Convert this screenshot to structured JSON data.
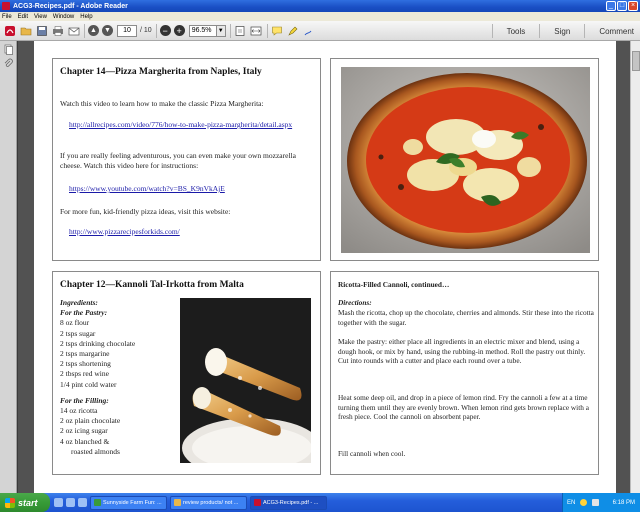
{
  "window": {
    "title": "ACG3-Recipes.pdf - Adobe Reader",
    "min": "_",
    "max": "□",
    "close": "×"
  },
  "menu": [
    "File",
    "Edit",
    "View",
    "Window",
    "Help"
  ],
  "toolbar": {
    "page_current": "10",
    "page_total": "/ 10",
    "zoom": "96.5%",
    "tools": "Tools",
    "sign": "Sign",
    "comment": "Comment"
  },
  "cards": {
    "pizza": {
      "title": "Chapter 14—Pizza Margherita from Naples, Italy",
      "p1": "Watch this video to learn how to make the classic Pizza Margherita:",
      "link1": "http://allrecipes.com/video/776/how-to-make-pizza-margherita/detail.aspx",
      "p2": "If you are really feeling adventurous, you can even make your own mozzarella cheese. Watch this video here for instructions:",
      "link2": "https://www.youtube.com/watch?v=BS_K9nVkAjE",
      "p3": "For more fun, kid-friendly pizza ideas, visit this website:",
      "link3": "http://www.pizzarecipesforkids.com/"
    },
    "cannoli": {
      "title": "Chapter 12—Kannoli Tal-Irkotta from Malta",
      "ingredients_label": "Ingredients:",
      "pastry_label": "For the Pastry:",
      "pastry": [
        "8 oz flour",
        "2 tsps sugar",
        "2 tsps drinking chocolate",
        "2 tsps margarine",
        "2 tsps shortening",
        "2 tbsps red wine",
        "1/4 pint cold water"
      ],
      "filling_label": "For the Filling:",
      "filling": [
        "14 oz ricotta",
        "2 oz plain chocolate",
        "2 oz icing sugar",
        "4 oz blanched &",
        "roasted almonds"
      ]
    },
    "continued": {
      "title": "Ricotta-Filled Cannoli, continued…",
      "directions_label": "Directions:",
      "d1": "Mash the ricotta, chop up the chocolate, cherries and almonds. Stir these into the ricotta together with the sugar.",
      "d2": "Make the pastry: either place all ingredients in an electric mixer and blend, using a dough hook, or mix by hand, using the rubbing-in method. Roll the pastry out thinly. Cut into rounds with a cutter and place each round over a tube.",
      "d3": "Heat some deep oil, and drop in a piece of lemon rind. Fry the cannoli a few at a time turning them until they are evenly brown. When lemon rind gets brown replace with a fresh piece. Cool the cannoli on absorbent paper.",
      "d4": "Fill cannoli when cool."
    }
  },
  "taskbar": {
    "start": "start",
    "tasks": [
      "Sunnyside Farm Fun: ...",
      "review products/ not ...",
      "ACG3-Recipes.pdf - ..."
    ],
    "lang": "EN",
    "clock": "6:18 PM"
  },
  "colors": {
    "accent": "#245edb",
    "link": "#1a1aa8",
    "start": "#379b37"
  }
}
